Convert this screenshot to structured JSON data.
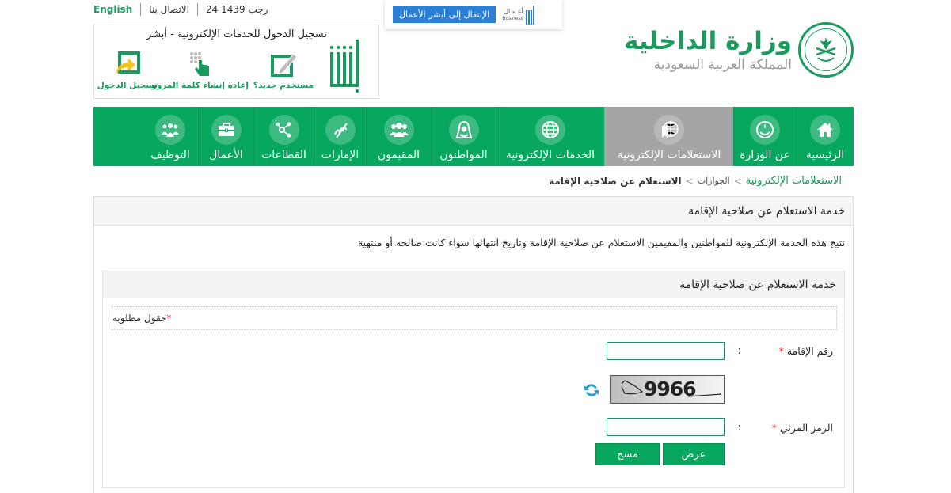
{
  "topbar": {
    "language_link": "English",
    "contact_link": "الاتصال بنا",
    "hijri_date": "24 رجب 1439"
  },
  "business_banner": {
    "button_label": "الإنتقال إلى أبشر الأعمال",
    "logo_text_ar": "أعـمـال",
    "logo_text_en": "Business",
    "brand_color": "#2c7fd6"
  },
  "login_box": {
    "title": "تسجيل الدخول للخدمات الإلكترونية - أبشر",
    "items": [
      {
        "label": "مستخدم جديد؟",
        "icon": "new-user-edit-icon"
      },
      {
        "label": "إعادة إنشاء كلمة المرور",
        "icon": "keypad-hand-icon"
      },
      {
        "label": "تسجيل الدخول",
        "icon": "login-arrow-icon"
      }
    ]
  },
  "ministry": {
    "name": "وزارة الداخلية",
    "country": "المملكة العربية السعودية",
    "brand_color": "#1a9b5e"
  },
  "nav": {
    "items": [
      {
        "label": "الرئيسية",
        "icon": "home-icon",
        "active": false
      },
      {
        "label": "عن الوزارة",
        "icon": "emblem-icon",
        "active": false
      },
      {
        "label": "الاستعلامات الإلكترونية",
        "icon": "globe-bookmark-icon",
        "active": true
      },
      {
        "label": "الخدمات الإلكترونية",
        "icon": "globe-icon",
        "active": false
      },
      {
        "label": "المواطنون",
        "icon": "citizen-icon",
        "active": false
      },
      {
        "label": "المقيمون",
        "icon": "residents-group-icon",
        "active": false
      },
      {
        "label": "الإمارات",
        "icon": "calligraphy-icon",
        "active": false
      },
      {
        "label": "القطاعات",
        "icon": "share-nodes-icon",
        "active": false
      },
      {
        "label": "الأعمال",
        "icon": "briefcase-icon",
        "active": false
      },
      {
        "label": "التوظيف",
        "icon": "team-icon",
        "active": false
      }
    ],
    "bg_color": "#07a75f",
    "active_color": "#a5a5a5"
  },
  "breadcrumb": {
    "items": [
      "الاستعلامات الإلكترونية",
      "الجوازات",
      "الاستعلام عن صلاحية الإقامة"
    ],
    "separator": ">"
  },
  "main": {
    "title": "خدمة الاستعلام عن صلاحية الإقامة",
    "description": "تتيح هذه الخدمة الإلكترونية للمواطنين والمقيمين الاستعلام عن صلاحية الإقامة وتاريخ انتهائها سواء كانت صالحة أو منتهية",
    "form": {
      "title": "خدمة الاستعلام عن صلاحية الإقامة",
      "required_note": "حقول مطلوبة",
      "required_marker": "*",
      "fields": [
        {
          "label": "رقم الإقامة",
          "value": "",
          "placeholder": ""
        },
        {
          "label": "الرمز المرئي",
          "value": "",
          "placeholder": ""
        }
      ],
      "colon": ":",
      "captcha_text": "9966",
      "buttons": {
        "submit": "عرض",
        "clear": "مسح"
      }
    }
  }
}
